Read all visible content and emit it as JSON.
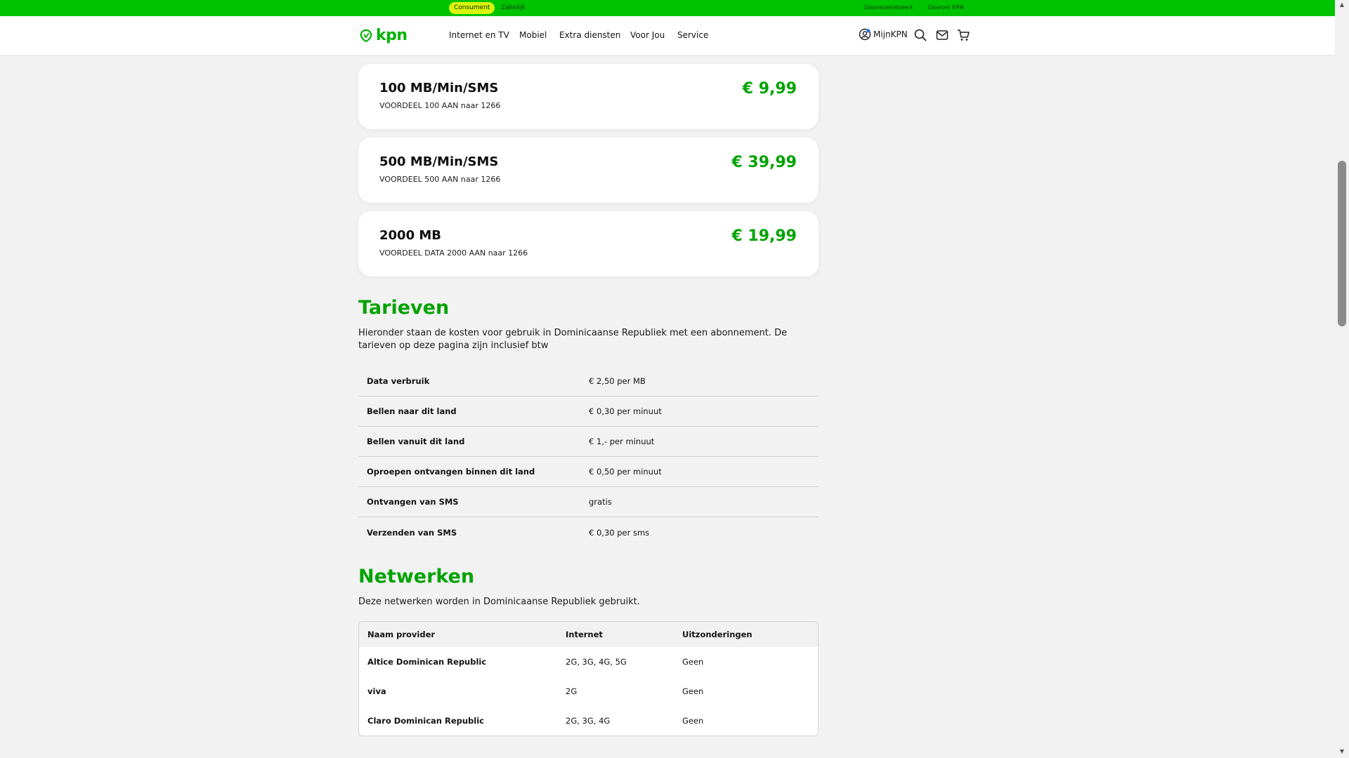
{
  "topbar": {
    "segments": [
      "Consument",
      "Zakelijk"
    ],
    "links": [
      "Glasvezelnetwerk",
      "Daarom KPN"
    ]
  },
  "nav": {
    "logo": "kpn",
    "items": [
      "Internet en TV",
      "Mobiel",
      "Extra diensten",
      "Voor Jou",
      "Service"
    ],
    "account": "MijnKPN"
  },
  "bundles": [
    {
      "title": "100 MB/Min/SMS",
      "sub": "VOORDEEL 100 AAN naar 1266",
      "price": "€ 9,99"
    },
    {
      "title": "500 MB/Min/SMS",
      "sub": "VOORDEEL 500 AAN naar 1266",
      "price": "€ 39,99"
    },
    {
      "title": "2000 MB",
      "sub": "VOORDEEL DATA 2000 AAN naar 1266",
      "price": "€ 19,99"
    }
  ],
  "tarieven": {
    "heading": "Tarieven",
    "intro": "Hieronder staan de kosten voor gebruik in Dominicaanse Republiek met een abonnement. De tarieven op deze pagina zijn inclusief btw",
    "rows": [
      {
        "label": "Data verbruik",
        "value": "€ 2,50 per MB"
      },
      {
        "label": "Bellen naar dit land",
        "value": "€ 0,30 per minuut"
      },
      {
        "label": "Bellen vanuit dit land",
        "value": "€ 1,- per minuut"
      },
      {
        "label": "Oproepen ontvangen binnen dit land",
        "value": "€ 0,50 per minuut"
      },
      {
        "label": "Ontvangen van SMS",
        "value": "gratis"
      },
      {
        "label": "Verzenden van SMS",
        "value": "€ 0,30 per sms"
      }
    ]
  },
  "netwerken": {
    "heading": "Netwerken",
    "intro": "Deze netwerken worden in Dominicaanse Republiek gebruikt.",
    "columns": [
      "Naam provider",
      "Internet",
      "Uitzonderingen"
    ],
    "rows": [
      {
        "provider": "Altice Dominican Republic",
        "internet": "2G, 3G, 4G, 5G",
        "exceptions": "Geen"
      },
      {
        "provider": "viva",
        "internet": "2G",
        "exceptions": "Geen"
      },
      {
        "provider": "Claro Dominican Republic",
        "internet": "2G, 3G, 4G",
        "exceptions": "Geen"
      }
    ]
  },
  "colors": {
    "brand": "#00c300",
    "price": "#00a300",
    "pill": "#d8f60a"
  },
  "icons": [
    "kpn-logo-icon",
    "user-icon",
    "search-icon",
    "mail-icon",
    "cart-icon"
  ]
}
